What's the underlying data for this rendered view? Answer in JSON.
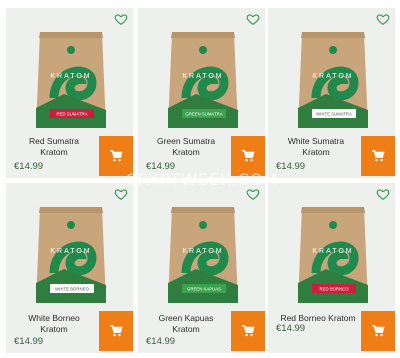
{
  "products": [
    {
      "name_line1": "Red Sumatra",
      "name_line2": "Kratom",
      "bag_label": "RED SUMATRA",
      "price": "€14.99",
      "stripe": "#c8203e"
    },
    {
      "name_line1": "Green Sumatra",
      "name_line2": "Kratom",
      "bag_label": "GREEN SUMATRA",
      "price": "€14.99",
      "stripe": "#3aa14d"
    },
    {
      "name_line1": "White Sumatra",
      "name_line2": "Kratom",
      "bag_label": "WHITE SUMATRA",
      "price": "€14.99",
      "stripe": "#ffffff"
    },
    {
      "name_line1": "White Borneo",
      "name_line2": "Kratom",
      "bag_label": "WHITE BORNEO",
      "price": "€14.99",
      "stripe": "#ffffff"
    },
    {
      "name_line1": "Green Kapuas",
      "name_line2": "Kratom",
      "bag_label": "GREEN KAPUAS",
      "price": "€14.99",
      "stripe": "#3aa14d"
    },
    {
      "name_line1": "Red Borneo Kratom",
      "name_line2": "",
      "bag_label": "RED BORNEO",
      "price": "€14.99",
      "stripe": "#c8203e"
    }
  ],
  "bag_brand": "KRATOM",
  "watermark": "CRYPTWEEK.COM",
  "colors": {
    "accent": "#ef7e16",
    "price": "#2e5e3c",
    "card_bg": "#eef0ee",
    "kraft": "#c8a57a",
    "brand_green": "#1f8a4c"
  },
  "icons": {
    "heart": "heart-icon",
    "cart": "cart-icon"
  }
}
